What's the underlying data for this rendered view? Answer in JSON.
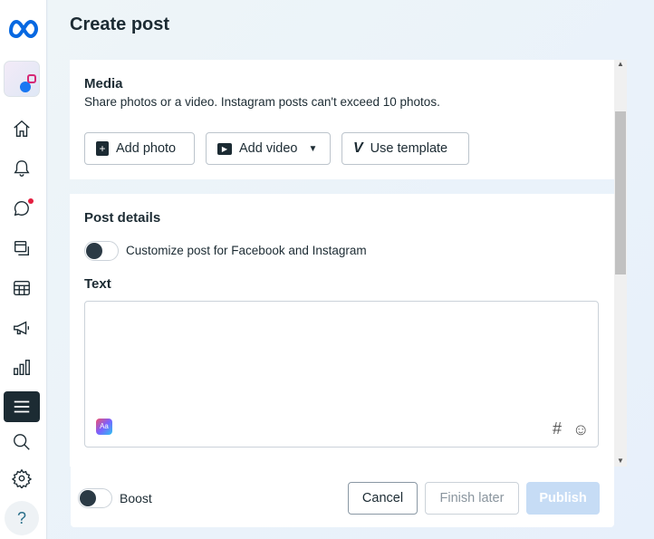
{
  "page": {
    "title": "Create post"
  },
  "sidebar": {
    "items": [
      {
        "name": "home",
        "label": "Home"
      },
      {
        "name": "notifications",
        "label": "Notifications"
      },
      {
        "name": "inbox",
        "label": "Inbox"
      },
      {
        "name": "content",
        "label": "Content"
      },
      {
        "name": "planner",
        "label": "Planner"
      },
      {
        "name": "ads",
        "label": "Ads"
      },
      {
        "name": "insights",
        "label": "Insights"
      },
      {
        "name": "all-tools",
        "label": "All tools"
      },
      {
        "name": "search",
        "label": "Search"
      },
      {
        "name": "settings",
        "label": "Settings"
      },
      {
        "name": "help",
        "label": "?"
      }
    ]
  },
  "media": {
    "heading": "Media",
    "description": "Share photos or a video. Instagram posts can't exceed 10 photos.",
    "add_photo": "Add photo",
    "add_video": "Add video",
    "use_template": "Use template"
  },
  "details": {
    "heading": "Post details",
    "customize_label": "Customize post for Facebook and Instagram",
    "text_label": "Text",
    "text_value": "",
    "hashtag": "#"
  },
  "footer": {
    "boost": "Boost",
    "cancel": "Cancel",
    "finish_later": "Finish later",
    "publish": "Publish"
  },
  "colors": {
    "accent": "#0064e0",
    "publish_disabled": "#c6dcf5"
  }
}
